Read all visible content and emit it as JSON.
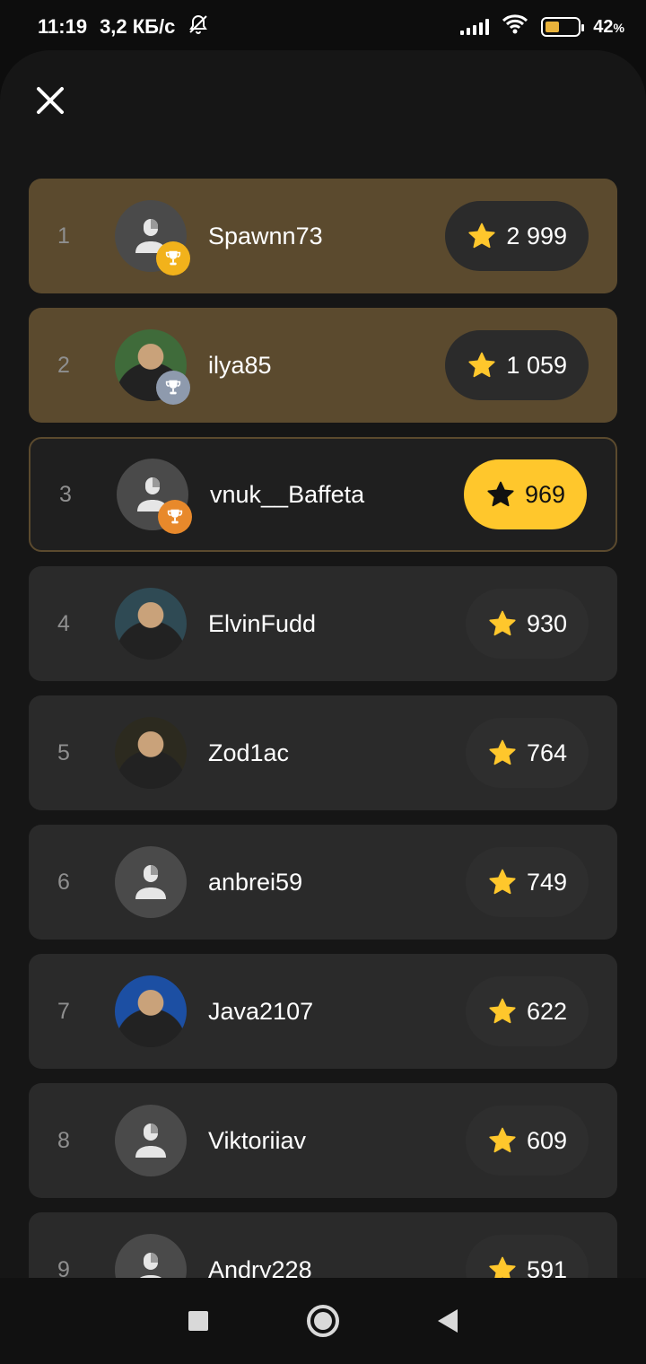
{
  "status": {
    "time": "11:19",
    "net_speed": "3,2 КБ/с",
    "battery": "42",
    "battery_unit": "%",
    "battery_level": 0.42
  },
  "icons": {
    "close": "close-icon",
    "star": "star-icon",
    "trophy": "trophy-icon",
    "avatar_placeholder": "person-icon"
  },
  "colors": {
    "gold_row": "#5b4a2e",
    "highlight_score": "#ffc72c",
    "trophy_gold": "#f2b21b",
    "trophy_silver": "#8e9aad",
    "trophy_bronze": "#e8892b"
  },
  "leaderboard": [
    {
      "rank": "1",
      "name": "Spawnn73",
      "score": "2 999"
    },
    {
      "rank": "2",
      "name": "ilya85",
      "score": "1 059"
    },
    {
      "rank": "3",
      "name": "vnuk__Baffeta",
      "score": "969"
    },
    {
      "rank": "4",
      "name": "ElvinFudd",
      "score": "930"
    },
    {
      "rank": "5",
      "name": "Zod1ac",
      "score": "764"
    },
    {
      "rank": "6",
      "name": "anbrei59",
      "score": "749"
    },
    {
      "rank": "7",
      "name": "Java2107",
      "score": "622"
    },
    {
      "rank": "8",
      "name": "Viktoriiav",
      "score": "609"
    },
    {
      "rank": "9",
      "name": "Andry228",
      "score": "591"
    }
  ]
}
